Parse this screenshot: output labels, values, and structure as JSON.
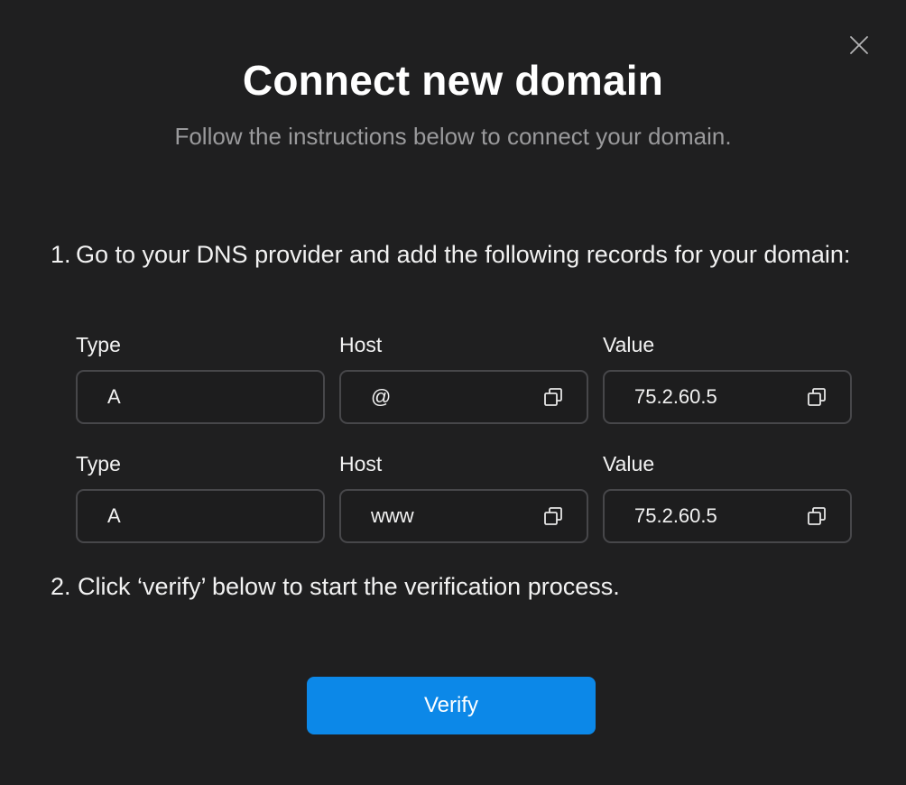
{
  "dialog": {
    "title": "Connect new domain",
    "subtitle": "Follow the instructions below to connect your domain.",
    "close_icon": "close-icon"
  },
  "steps": [
    {
      "number": "1.",
      "text": "Go to your DNS provider and add the following records for your domain:"
    },
    {
      "text": "2. Click ‘verify’ below to start the verification process."
    }
  ],
  "records": [
    {
      "type_label": "Type",
      "type_value": "A",
      "host_label": "Host",
      "host_value": "@",
      "value_label": "Value",
      "value_value": "75.2.60.5"
    },
    {
      "type_label": "Type",
      "type_value": "A",
      "host_label": "Host",
      "host_value": "www",
      "value_label": "Value",
      "value_value": "75.2.60.5"
    }
  ],
  "actions": {
    "verify_label": "Verify"
  },
  "colors": {
    "background": "#1f1f20",
    "accent": "#0c88e8",
    "field_border": "#47474a",
    "muted_text": "#9a9a9c"
  }
}
